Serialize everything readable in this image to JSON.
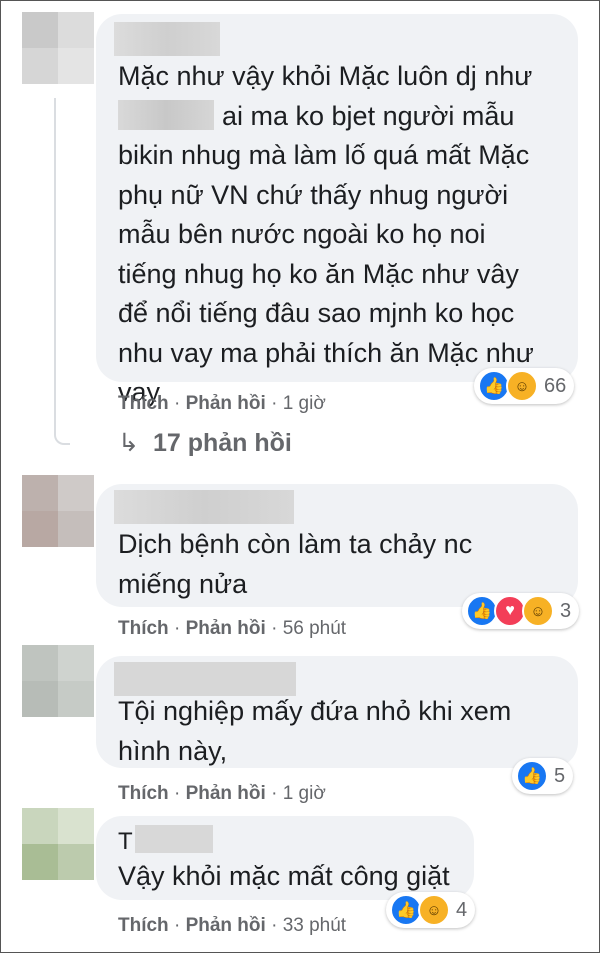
{
  "colors": {
    "bubble": "#f0f2f5",
    "like_blue": "#1877f2",
    "haha_yellow": "#f7b125",
    "love_red": "#f33e58",
    "meta_gray": "#65676b"
  },
  "comments": [
    {
      "lines": [
        "Mặc như vậy khỏi Mặc luôn dj như",
        "ai ma ko bjet người mẫu",
        "bikin nhug mà làm lố quá mất Mặc",
        "phụ nữ VN chứ thấy nhug người",
        "mẫu bên nước ngoài ko họ noi",
        "tiếng nhug họ ko ăn Mặc như vây",
        "để nổi tiếng đâu sao mjnh ko học",
        "nhu vay ma phải thích ăn Mặc như",
        "vay"
      ],
      "like": "Thích",
      "reply": "Phản hồi",
      "time": "1 giờ",
      "reaction_icons": [
        "like-icon",
        "haha-icon"
      ],
      "reaction_count": "66"
    },
    {
      "lines": [
        "Dịch bệnh còn làm ta chảy nc",
        "miếng nửa"
      ],
      "like": "Thích",
      "reply": "Phản hồi",
      "time": "56 phút",
      "reaction_icons": [
        "like-icon",
        "love-icon",
        "haha-icon"
      ],
      "reaction_count": "3"
    },
    {
      "lines": [
        "Tội nghiệp mấy đứa nhỏ khi xem",
        "hình này,"
      ],
      "like": "Thích",
      "reply": "Phản hồi",
      "time": "1 giờ",
      "reaction_icons": [
        "like-icon"
      ],
      "reaction_count": "5"
    },
    {
      "name_initial": "T",
      "lines": [
        "Vậy khỏi mặc mất công giặt"
      ],
      "like": "Thích",
      "reply": "Phản hồi",
      "time": "33 phút",
      "reaction_icons": [
        "like-icon",
        "haha-icon"
      ],
      "reaction_count": "4"
    }
  ],
  "replies_link": {
    "arrow": "↳",
    "label": "17 phản hồi"
  },
  "separator": "·"
}
